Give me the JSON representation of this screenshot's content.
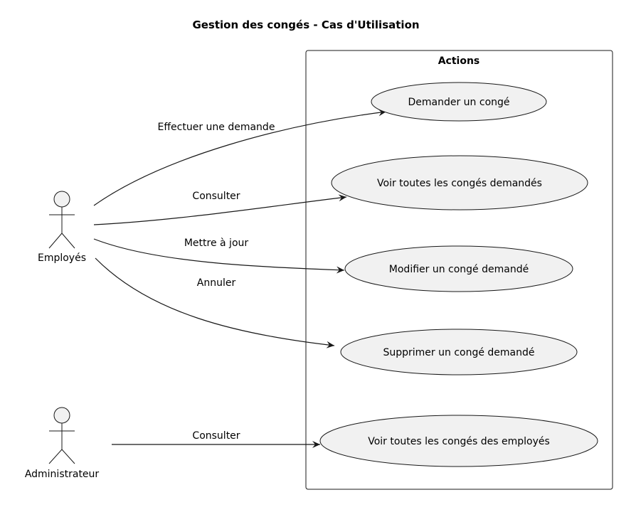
{
  "title": "Gestion des congés - Cas d'Utilisation",
  "package": {
    "label": "Actions"
  },
  "actors": [
    {
      "id": "employes",
      "label": "Employés"
    },
    {
      "id": "admin",
      "label": "Administrateur"
    }
  ],
  "use_cases": [
    {
      "label": "Demander un congé"
    },
    {
      "label": "Voir toutes les congés demandés"
    },
    {
      "label": "Modifier un congé demandé"
    },
    {
      "label": "Supprimer un congé demandé"
    },
    {
      "label": "Voir toutes les congés des employés"
    }
  ],
  "edges": [
    {
      "from": "Employés",
      "to": "Demander un congé",
      "label": "Effectuer une demande"
    },
    {
      "from": "Employés",
      "to": "Voir toutes les congés demandés",
      "label": "Consulter"
    },
    {
      "from": "Employés",
      "to": "Modifier un congé demandé",
      "label": "Mettre à jour"
    },
    {
      "from": "Employés",
      "to": "Supprimer un congé demandé",
      "label": "Annuler"
    },
    {
      "from": "Administrateur",
      "to": "Voir toutes les congés des employés",
      "label": "Consulter"
    }
  ],
  "colors": {
    "fill": "#f1f1f1",
    "stroke": "#181818"
  }
}
